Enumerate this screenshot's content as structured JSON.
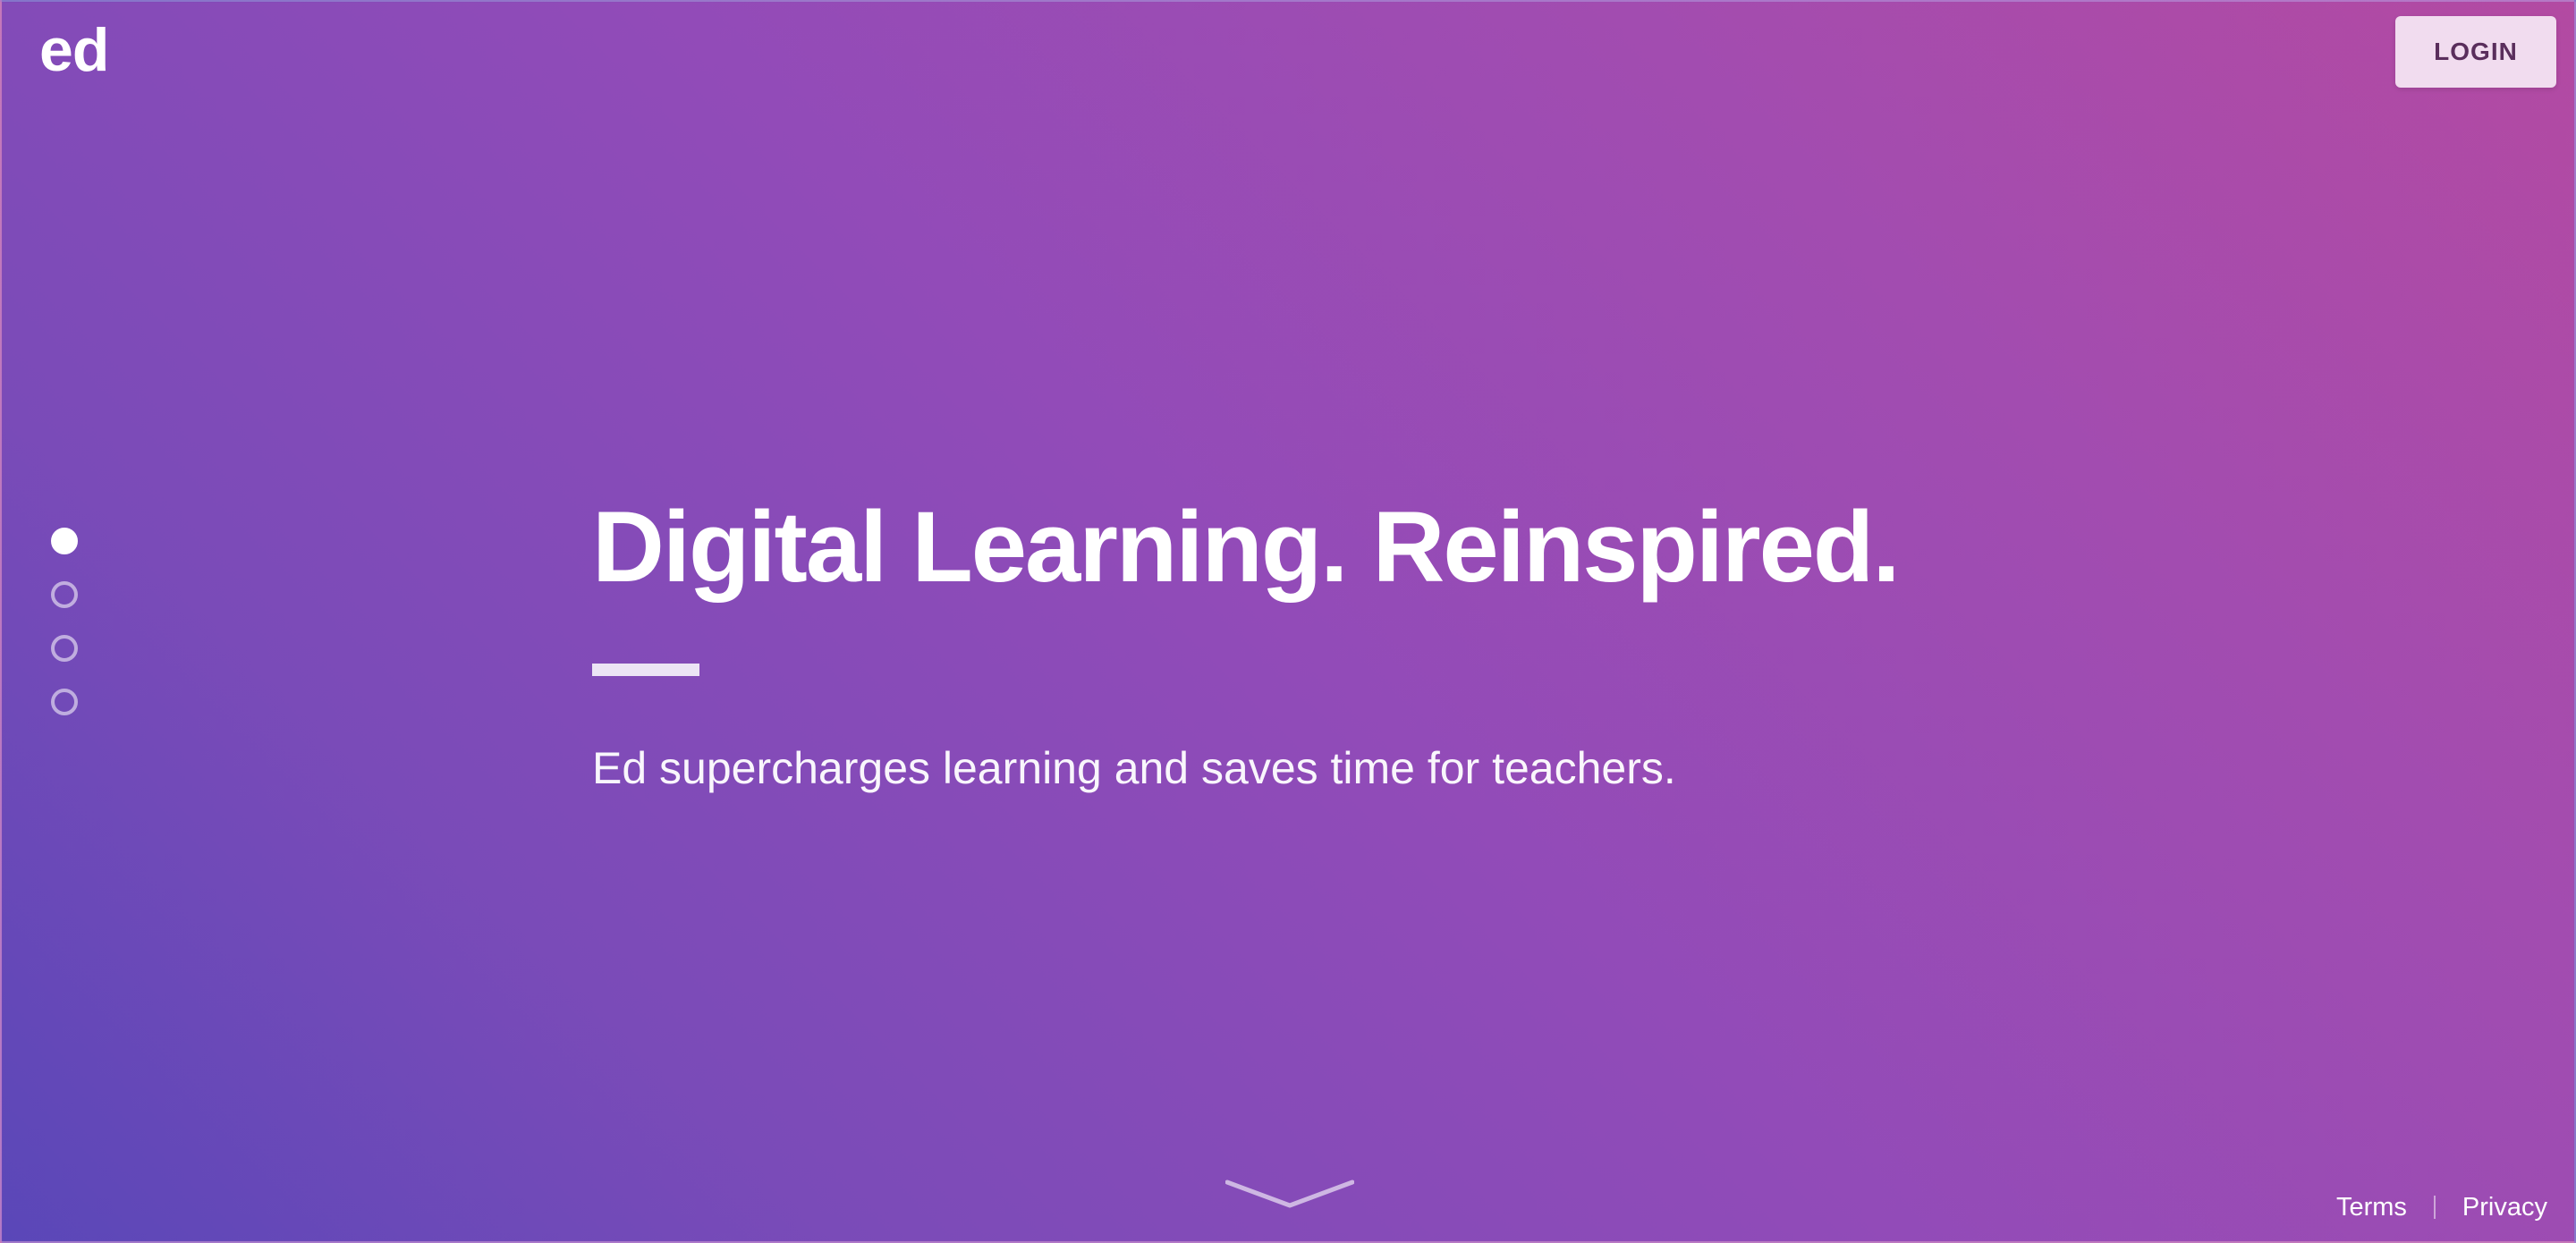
{
  "header": {
    "logo_text": "ed",
    "login_label": "LOGIN"
  },
  "carousel": {
    "slide_count": 4,
    "active_index": 0
  },
  "hero": {
    "headline": "Digital Learning. Reinspired.",
    "subtext": "Ed supercharges learning and saves time for teachers."
  },
  "scroll": {
    "icon": "chevron-down-icon"
  },
  "footer": {
    "terms_label": "Terms",
    "privacy_label": "Privacy"
  },
  "colors": {
    "gradient_start": "#5a47b8",
    "gradient_mid": "#924bb8",
    "gradient_end": "#b34aa2",
    "login_bg": "#f1dcef",
    "login_text": "#5a2e5c"
  }
}
